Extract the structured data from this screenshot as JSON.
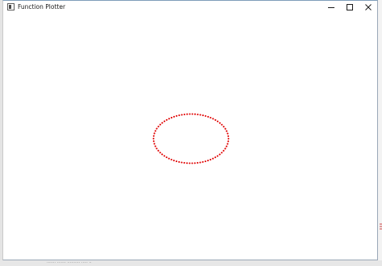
{
  "window": {
    "title": "Function Plotter",
    "controls": {
      "minimize": "minimize-icon",
      "maximize": "maximize-icon",
      "close": "close-icon"
    }
  },
  "plot": {
    "shape": "ellipse",
    "stroke_color": "#e00000",
    "stroke_style": "dotted"
  },
  "background_taskbar": {
    "text": "·······  ·······  ··········  ·····  ··"
  },
  "colors": {
    "window_background": "#ffffff",
    "curve": "#e00000"
  }
}
